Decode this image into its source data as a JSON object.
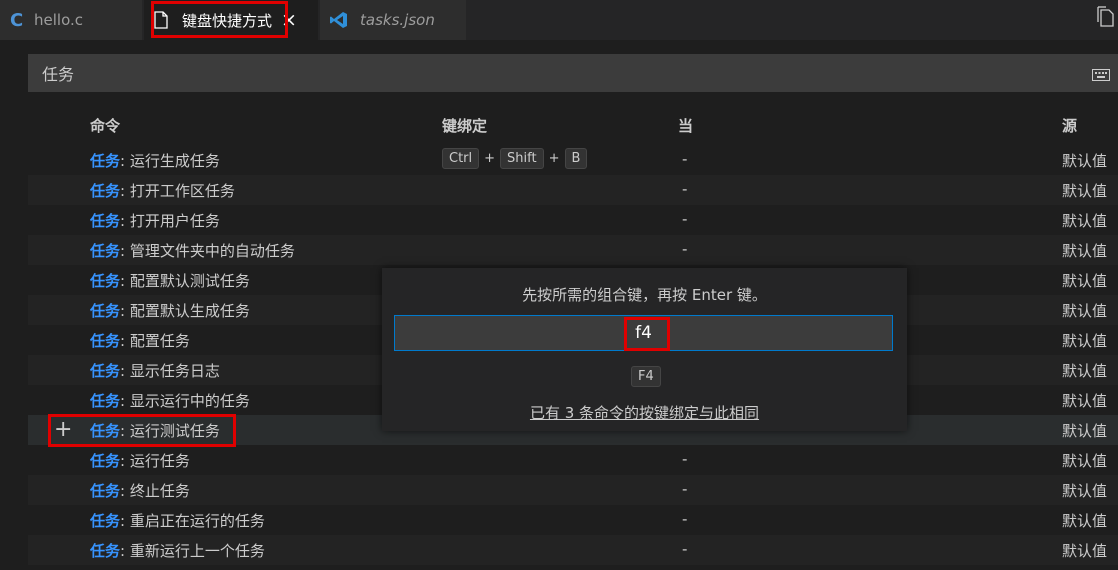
{
  "tabs": [
    {
      "label": "hello.c",
      "icon": "c-file-icon"
    },
    {
      "label": "键盘快捷方式",
      "icon": "file-icon",
      "close": "×"
    },
    {
      "label": "tasks.json",
      "icon": "vscode-icon"
    }
  ],
  "search": {
    "value": "任务"
  },
  "columns": {
    "command": "命令",
    "keybinding": "键绑定",
    "when": "当",
    "source": "源"
  },
  "rows": [
    {
      "category": "任务",
      "command": ": 运行生成任务",
      "keys": [
        "Ctrl",
        "Shift",
        "B"
      ],
      "key_sep": "+",
      "when": "-",
      "source": "默认值"
    },
    {
      "category": "任务",
      "command": ": 打开工作区任务",
      "when": "-",
      "source": "默认值"
    },
    {
      "category": "任务",
      "command": ": 打开用户任务",
      "when": "-",
      "source": "默认值"
    },
    {
      "category": "任务",
      "command": ": 管理文件夹中的自动任务",
      "when": "-",
      "source": "默认值"
    },
    {
      "category": "任务",
      "command": ": 配置默认测试任务",
      "when": "",
      "source": "默认值"
    },
    {
      "category": "任务",
      "command": ": 配置默认生成任务",
      "when": "",
      "source": "默认值"
    },
    {
      "category": "任务",
      "command": ": 配置任务",
      "when": "",
      "source": "默认值"
    },
    {
      "category": "任务",
      "command": ": 显示任务日志",
      "when": "",
      "source": "默认值"
    },
    {
      "category": "任务",
      "command": ": 显示运行中的任务",
      "when": "",
      "source": "默认值"
    },
    {
      "category": "任务",
      "command": ": 运行测试任务",
      "when": "-",
      "source": "默认值"
    },
    {
      "category": "任务",
      "command": ": 运行任务",
      "when": "-",
      "source": "默认值"
    },
    {
      "category": "任务",
      "command": ": 终止任务",
      "when": "-",
      "source": "默认值"
    },
    {
      "category": "任务",
      "command": ": 重启正在运行的任务",
      "when": "-",
      "source": "默认值"
    },
    {
      "category": "任务",
      "command": ": 重新运行上一个任务",
      "when": "-",
      "source": "默认值"
    }
  ],
  "add_icon": "+",
  "widget": {
    "message": "先按所需的组合键，再按 Enter 键。",
    "input_value": "f4",
    "chord": "F4",
    "conflict_link": "已有 3 条命令的按键绑定与此相同"
  },
  "colors": {
    "accent": "#3794ff",
    "highlight": "#e00000",
    "focus_border": "#007acc"
  }
}
